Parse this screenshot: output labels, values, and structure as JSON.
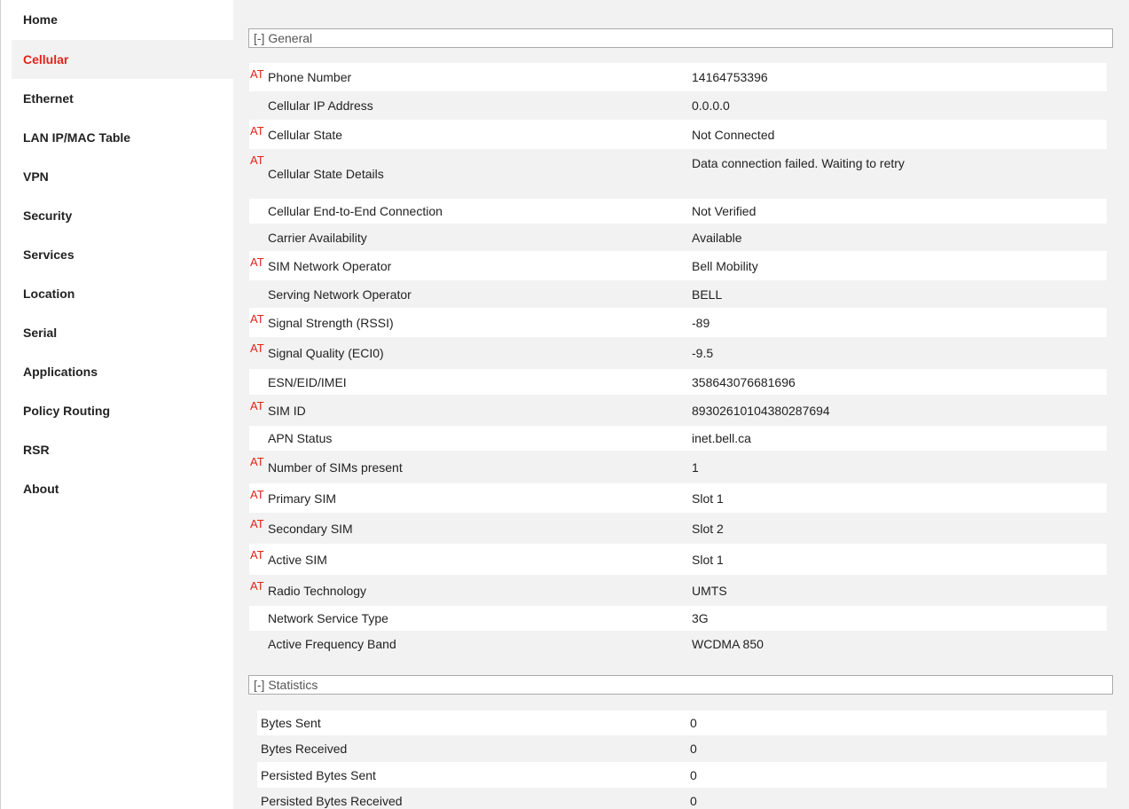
{
  "sidebar": {
    "items": [
      {
        "label": "Home"
      },
      {
        "label": "Cellular",
        "active": true
      },
      {
        "label": "Ethernet"
      },
      {
        "label": "LAN IP/MAC Table"
      },
      {
        "label": "VPN"
      },
      {
        "label": "Security"
      },
      {
        "label": "Services"
      },
      {
        "label": "Location"
      },
      {
        "label": "Serial"
      },
      {
        "label": "Applications"
      },
      {
        "label": "Policy Routing"
      },
      {
        "label": "RSR"
      },
      {
        "label": "About"
      }
    ]
  },
  "general": {
    "title": "[-] General",
    "at_marker": "AT",
    "rows": [
      {
        "label": "Phone Number",
        "value": "14164753396",
        "at": true
      },
      {
        "label": "Cellular IP Address",
        "value": "0.0.0.0",
        "at": false
      },
      {
        "label": "Cellular State",
        "value": "Not Connected",
        "at": true
      },
      {
        "label": "Cellular State Details",
        "value": "Data connection failed. Waiting to retry",
        "at": true
      },
      {
        "label": "Cellular End-to-End Connection",
        "value": "Not Verified",
        "at": false
      },
      {
        "label": "Carrier Availability",
        "value": "Available",
        "at": false
      },
      {
        "label": "SIM Network Operator",
        "value": "Bell Mobility",
        "at": true
      },
      {
        "label": "Serving Network Operator",
        "value": "BELL",
        "at": false
      },
      {
        "label": "Signal Strength (RSSI)",
        "value": "-89",
        "at": true
      },
      {
        "label": "Signal Quality (ECI0)",
        "value": "-9.5",
        "at": true
      },
      {
        "label": "ESN/EID/IMEI",
        "value": "358643076681696",
        "at": false
      },
      {
        "label": "SIM ID",
        "value": "89302610104380287694",
        "at": true
      },
      {
        "label": "APN Status",
        "value": "inet.bell.ca",
        "at": false
      },
      {
        "label": "Number of SIMs present",
        "value": "1",
        "at": true
      },
      {
        "label": "Primary SIM",
        "value": "Slot 1",
        "at": true
      },
      {
        "label": "Secondary SIM",
        "value": "Slot 2",
        "at": true
      },
      {
        "label": "Active SIM",
        "value": "Slot 1",
        "at": true
      },
      {
        "label": "Radio Technology",
        "value": "UMTS",
        "at": true
      },
      {
        "label": "Network Service Type",
        "value": "3G",
        "at": false
      },
      {
        "label": "Active Frequency Band",
        "value": "WCDMA 850",
        "at": false
      }
    ]
  },
  "statistics": {
    "title": "[-] Statistics",
    "rows": [
      {
        "label": "Bytes Sent",
        "value": "0"
      },
      {
        "label": "Bytes Received",
        "value": "0"
      },
      {
        "label": "Persisted Bytes Sent",
        "value": "0"
      },
      {
        "label": "Persisted Bytes Received",
        "value": "0"
      }
    ]
  },
  "colors": {
    "accent": "#e2231a",
    "content_bg": "#f2f2f2",
    "row_bg": "#ffffff"
  }
}
